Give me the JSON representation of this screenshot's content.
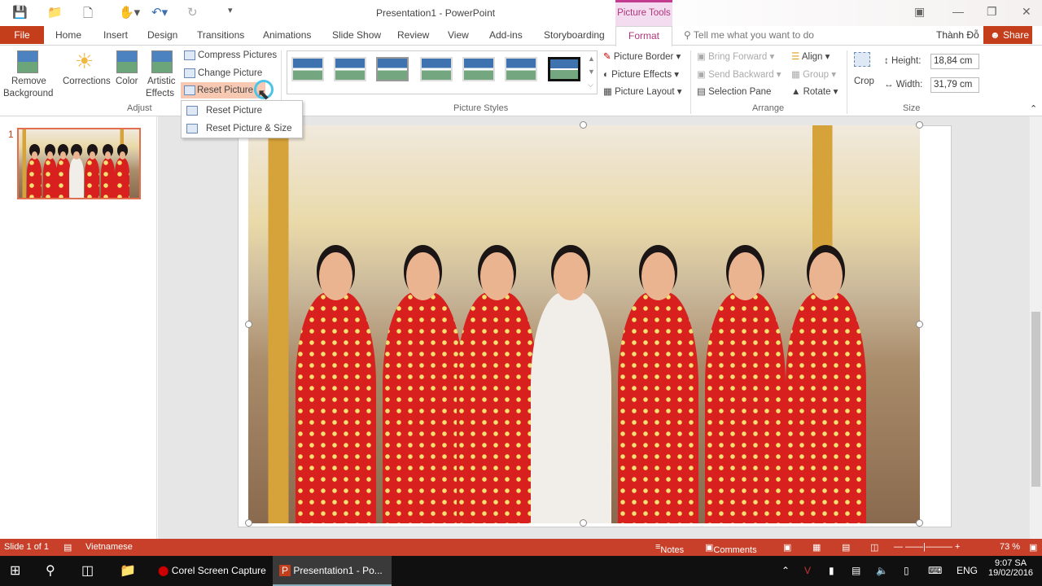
{
  "window": {
    "title": "Presentation1 - PowerPoint",
    "context_tab": "Picture Tools"
  },
  "tabs": [
    "File",
    "Home",
    "Insert",
    "Design",
    "Transitions",
    "Animations",
    "Slide Show",
    "Review",
    "View",
    "Add-ins",
    "Storyboarding",
    "Format"
  ],
  "active_tab": "Format",
  "tell_me": "Tell me what you want to do",
  "user": "Thành Đỗ",
  "share": "Share",
  "ribbon": {
    "adjust": {
      "remove_bg": [
        "Remove",
        "Background"
      ],
      "corrections": "Corrections",
      "color": "Color",
      "artistic": [
        "Artistic",
        "Effects"
      ],
      "compress": "Compress Pictures",
      "change": "Change Picture",
      "reset": "Reset Picture",
      "group": "Adjust"
    },
    "styles": {
      "group": "Picture Styles",
      "border": "Picture Border",
      "effects": "Picture Effects",
      "layout": "Picture Layout"
    },
    "arrange": {
      "group": "Arrange",
      "bring": "Bring Forward",
      "send": "Send Backward",
      "pane": "Selection Pane",
      "align": "Align",
      "grp": "Group",
      "rotate": "Rotate"
    },
    "size": {
      "group": "Size",
      "crop": "Crop",
      "height_label": "Height:",
      "height": "18,84 cm",
      "width_label": "Width:",
      "width": "31,79 cm"
    }
  },
  "reset_menu": [
    "Reset Picture",
    "Reset Picture & Size"
  ],
  "slides": {
    "number": "1"
  },
  "status": {
    "slide": "Slide 1 of 1",
    "language": "Vietnamese",
    "notes": "Notes",
    "comments": "Comments",
    "zoom": "73 %",
    "zoom_value": 73
  },
  "taskbar": {
    "apps": [
      "Corel Screen Capture",
      "Presentation1 - Po..."
    ],
    "lang": "ENG",
    "time": "9:07 SA",
    "date": "19/02/2016"
  },
  "colors": {
    "accent": "#c43e1c",
    "picture_tools": "#b0367c"
  }
}
